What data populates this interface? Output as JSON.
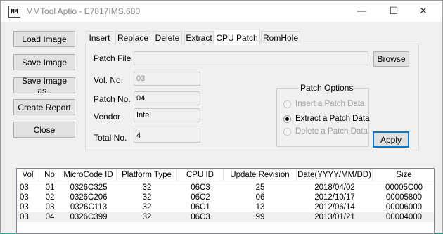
{
  "window": {
    "icon_text": "MM",
    "title": "MMTool Aptio - E7817IMS.680",
    "minimize_glyph": "—",
    "maximize_glyph": "☐",
    "close_glyph": "✕"
  },
  "side_buttons": {
    "load": "Load Image",
    "save": "Save Image",
    "save_as": "Save Image as..",
    "report": "Create Report",
    "close": "Close"
  },
  "tabs": [
    "Insert",
    "Replace",
    "Delete",
    "Extract",
    "CPU Patch",
    "RomHole"
  ],
  "active_tab": "CPU Patch",
  "patch": {
    "patch_file_label": "Patch File",
    "patch_file_value": "",
    "browse": "Browse",
    "vol_no_label": "Vol. No.",
    "vol_no_value": "03",
    "patch_no_label": "Patch No.",
    "patch_no_value": "04",
    "vendor_label": "Vendor",
    "vendor_value": "Intel",
    "total_no_label": "Total No.",
    "total_no_value": "4"
  },
  "patch_options": {
    "title": "Patch Options",
    "insert": "Insert a Patch Data",
    "extract": "Extract a Patch Data",
    "delete": "Delete a Patch Data",
    "selected": "extract",
    "apply": "Apply"
  },
  "table": {
    "columns": [
      "Vol",
      "No",
      "MicroCode ID",
      "Platform Type",
      "CPU ID",
      "Update Revision",
      "Date(YYYY/MM/DD)",
      "Size"
    ],
    "rows": [
      [
        "03",
        "01",
        "0326C325",
        "32",
        "06C3",
        "25",
        "2018/04/02",
        "00005C00"
      ],
      [
        "03",
        "02",
        "0326C206",
        "32",
        "06C2",
        "06",
        "2012/10/17",
        "00005800"
      ],
      [
        "03",
        "03",
        "0326C113",
        "32",
        "06C1",
        "13",
        "2012/06/14",
        "00006000"
      ],
      [
        "03",
        "04",
        "0326C399",
        "32",
        "06C3",
        "99",
        "2013/01/21",
        "00004000"
      ]
    ],
    "selected_row": 3
  }
}
